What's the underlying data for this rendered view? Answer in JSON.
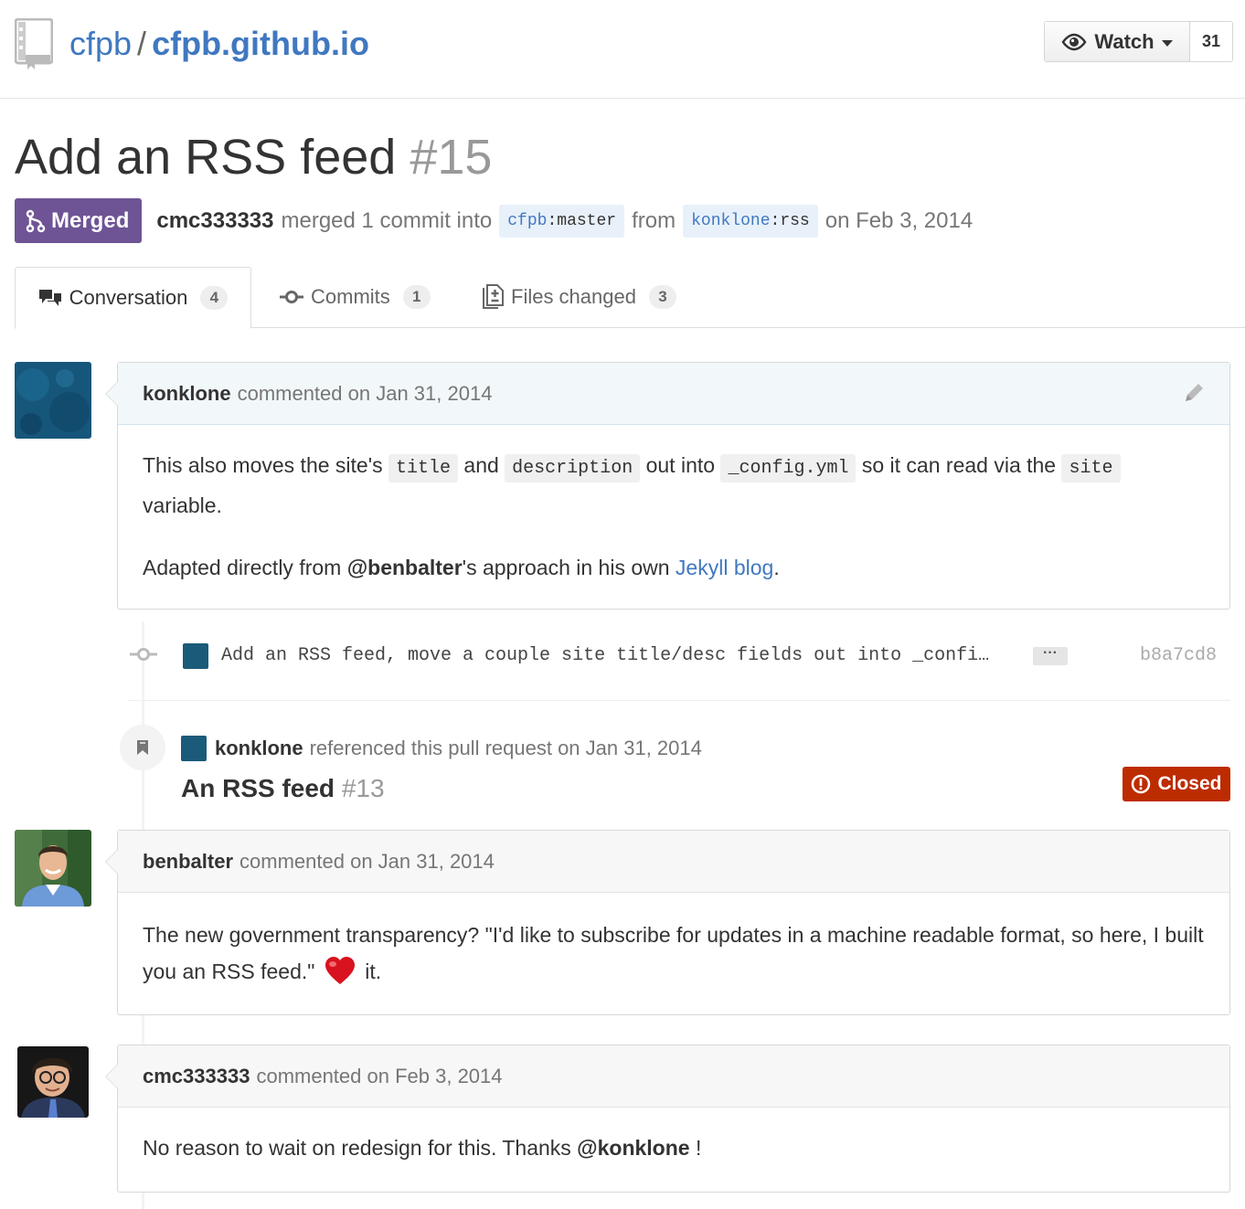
{
  "repo": {
    "owner": "cfpb",
    "separator": "/",
    "name": "cfpb.github.io"
  },
  "watch": {
    "label": "Watch",
    "count": "31"
  },
  "pr": {
    "title": "Add an RSS feed",
    "number": "#15",
    "state": "Merged",
    "merged_by": "cmc333333",
    "merge_text": "merged 1 commit into",
    "base_owner": "cfpb",
    "base_branch": ":master",
    "from_text": "from",
    "head_owner": "konklone",
    "head_branch": ":rss",
    "date_text": "on Feb 3, 2014"
  },
  "tabs": [
    {
      "label": "Conversation",
      "count": "4",
      "icon": "comment-discussion-icon"
    },
    {
      "label": "Commits",
      "count": "1",
      "icon": "git-commit-icon"
    },
    {
      "label": "Files changed",
      "count": "3",
      "icon": "file-diff-icon"
    }
  ],
  "comments": [
    {
      "author": "konklone",
      "action": "commented on Jan 31, 2014",
      "p1": {
        "t1": "This also moves the site's",
        "c1": "title",
        "t2": "and",
        "c2": "description",
        "t3": "out into",
        "c3": "_config.yml",
        "t4": "so it can read via the",
        "c4": "site",
        "t5": "variable."
      },
      "p2": {
        "t1": "Adapted directly from",
        "mention": "@benbalter",
        "t2": "'s approach in his own",
        "link": "Jekyll blog",
        "t3": "."
      }
    },
    {
      "author": "benbalter",
      "action": "commented on Jan 31, 2014",
      "t1": "The new government transparency? \"I'd like to subscribe for updates in a machine readable format, so here, I built you an RSS feed.\"",
      "emoji": "heart",
      "t2": "it."
    },
    {
      "author": "cmc333333",
      "action": "commented on Feb 3, 2014",
      "t1": "No reason to wait on redesign for this. Thanks",
      "mention": "@konklone",
      "t2": "!"
    }
  ],
  "commit": {
    "message": "Add an RSS feed, move a couple site title/desc fields out into _confi…",
    "ellipsis": "···",
    "sha": "b8a7cd8"
  },
  "reference": {
    "author": "konklone",
    "action": "referenced this pull request on Jan 31, 2014",
    "title": "An RSS feed",
    "number": "#13",
    "state": "Closed"
  },
  "colors": {
    "link": "#4078c0",
    "merged": "#6e5494",
    "closed": "#bd2c00"
  }
}
